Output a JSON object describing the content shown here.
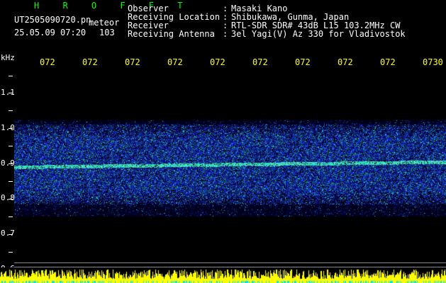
{
  "header": {
    "app_name": "H R O F F T",
    "filename": "UT2505090720.pn",
    "mode": "meteor",
    "datetime": "25.05.09 07:20",
    "count": "103"
  },
  "meta": [
    {
      "label": "Observer",
      "value": "Masaki Kano"
    },
    {
      "label": "Receiving Location",
      "value": "Shibukawa, Gunma, Japan"
    },
    {
      "label": "Receiver",
      "value": "RTL-SDR SDR# 43dB L15 103.2MHz CW"
    },
    {
      "label": "Receiving Antenna",
      "value": "3el Yagi(V) Az 330 for Vladivostok"
    }
  ],
  "meta_separator": ":",
  "axis": {
    "unit": "kHz",
    "y_ticks": [
      "1.1",
      "1.0",
      "0.9",
      "0.8",
      "0.7",
      "0.6"
    ],
    "time_ticks": [
      "072",
      "072",
      "072",
      "072",
      "072",
      "072",
      "072",
      "072",
      "072",
      "0730"
    ]
  },
  "colors": {
    "title": "#00ff00",
    "text": "#ffffff",
    "time_ticks": "#ffff00",
    "spectro_low": "#000044",
    "spectro_mid": "#2a62ff",
    "spectro_high": "#00ff88",
    "bars_yellow": "#ffff00",
    "bars_cyan": "#00e5ff"
  }
}
